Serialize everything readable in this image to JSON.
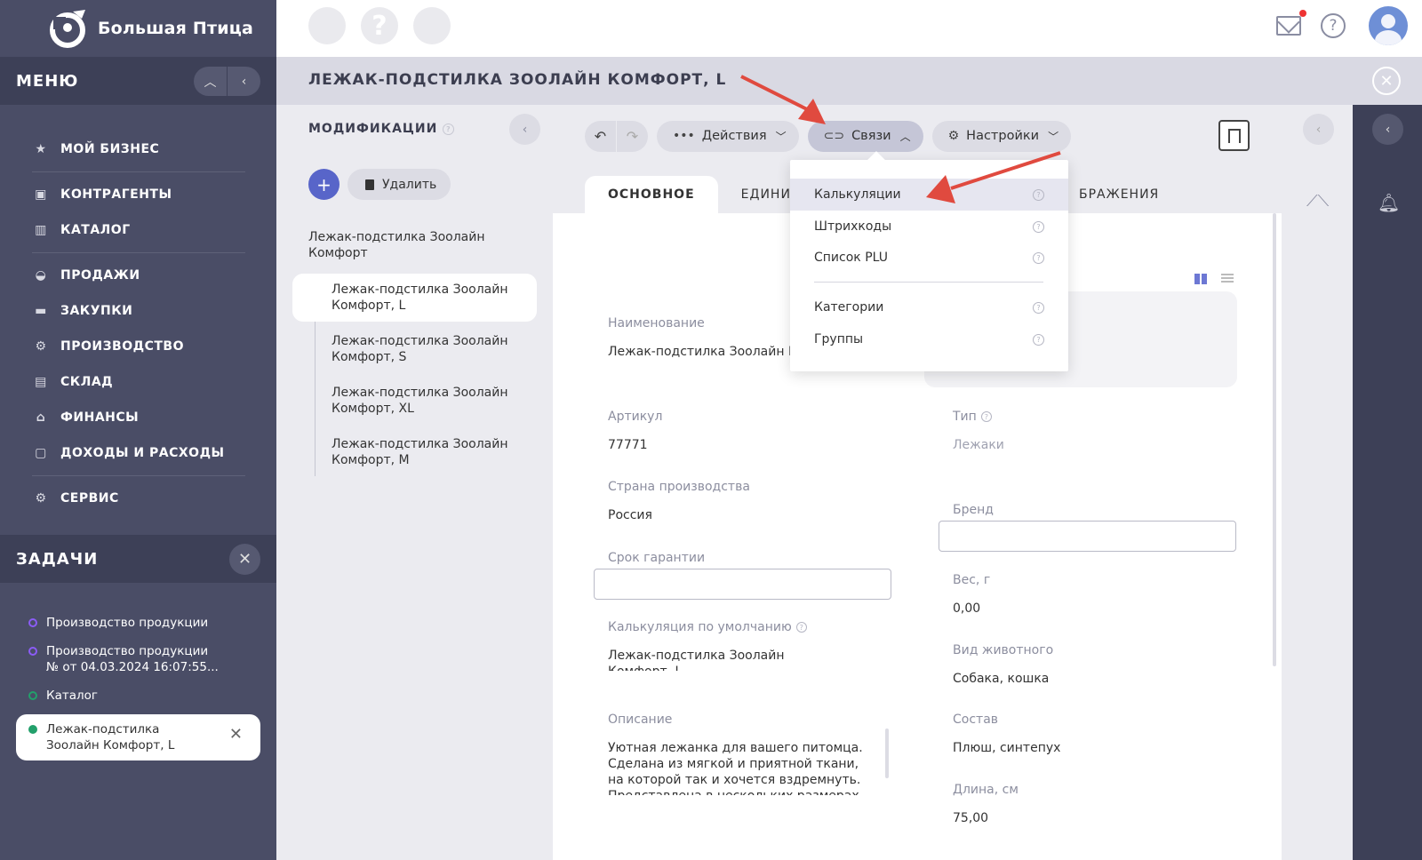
{
  "app": {
    "brand": "Большая Птица"
  },
  "topbar": {
    "q_circle": "?"
  },
  "sidebar": {
    "menu_title": "МЕНЮ",
    "items": [
      {
        "label": "МОЙ БИЗНЕС",
        "icon": "star-icon"
      },
      {
        "label": "КОНТРАГЕНТЫ",
        "icon": "briefcase-icon"
      },
      {
        "label": "КАТАЛОГ",
        "icon": "book-icon"
      },
      {
        "label": "ПРОДАЖИ",
        "icon": "basket-icon"
      },
      {
        "label": "ЗАКУПКИ",
        "icon": "truck-icon"
      },
      {
        "label": "ПРОИЗВОДСТВО",
        "icon": "robot-arm-icon"
      },
      {
        "label": "СКЛАД",
        "icon": "warehouse-icon"
      },
      {
        "label": "ФИНАНСЫ",
        "icon": "bank-icon"
      },
      {
        "label": "ДОХОДЫ И РАСХОДЫ",
        "icon": "wallet-icon"
      },
      {
        "label": "СЕРВИС",
        "icon": "gear-box-icon"
      }
    ],
    "tasks_title": "ЗАДАЧИ",
    "tasks": [
      {
        "label": "Производство продукции",
        "color": "#8b5cf6"
      },
      {
        "label": "Производство продукции № от 04.03.2024 16:07:55...",
        "color": "#8b5cf6"
      },
      {
        "label": "Каталог",
        "color": "#22a06b"
      },
      {
        "label": "Лежак-подстилка Зоолайн Комфорт, L",
        "color": "#22a06b"
      }
    ]
  },
  "page": {
    "title": "ЛЕЖАК-ПОДСТИЛКА ЗООЛАЙН КОМФОРТ, L"
  },
  "mods": {
    "title": "МОДИФИКАЦИИ",
    "delete_label": "Удалить",
    "root": "Лежак-подстилка Зоолайн Комфорт",
    "children": [
      "Лежак-подстилка Зоолайн Комфорт, L",
      "Лежак-подстилка Зоолайн Комфорт, S",
      "Лежак-подстилка Зоолайн Комфорт, XL",
      "Лежак-подстилка Зоолайн Комфорт, M"
    ]
  },
  "toolbar": {
    "actions": "Действия",
    "links": "Связи",
    "settings": "Настройки"
  },
  "tabs": [
    "ОСНОВНОЕ",
    "ЕДИНИ",
    "БРАЖЕНИЯ"
  ],
  "dropdown": {
    "items": [
      "Калькуляции",
      "Штрихкоды",
      "Список PLU",
      "Категории",
      "Группы"
    ]
  },
  "form": {
    "name_label": "Наименование",
    "name_value": "Лежак-подстилка Зоолайн Ко",
    "sku_label": "Артикул",
    "sku_value": "77771",
    "country_label": "Страна производства",
    "country_value": "Россия",
    "warranty_label": "Срок гарантии",
    "calc_label": "Калькуляция по умолчанию",
    "calc_value": "Лежак-подстилка Зоолайн",
    "calc_value_cut": "Комфорт, L",
    "desc_label": "Описание",
    "desc_value": "Уютная лежанка для вашего питомца. Сделана из мягкой и приятной ткани, на которой так и хочется вздремнуть.",
    "desc_cut": "Представлена в нескольких размерах",
    "type_label": "Тип",
    "type_value": "Лежаки",
    "brand_label": "Бренд",
    "weight_label": "Вес, г",
    "weight_value": "0,00",
    "animal_label": "Вид животного",
    "animal_value": "Собака, кошка",
    "composition_label": "Состав",
    "composition_value": "Плюш, синтепух",
    "length_label": "Длина, см",
    "length_value": "75,00"
  }
}
